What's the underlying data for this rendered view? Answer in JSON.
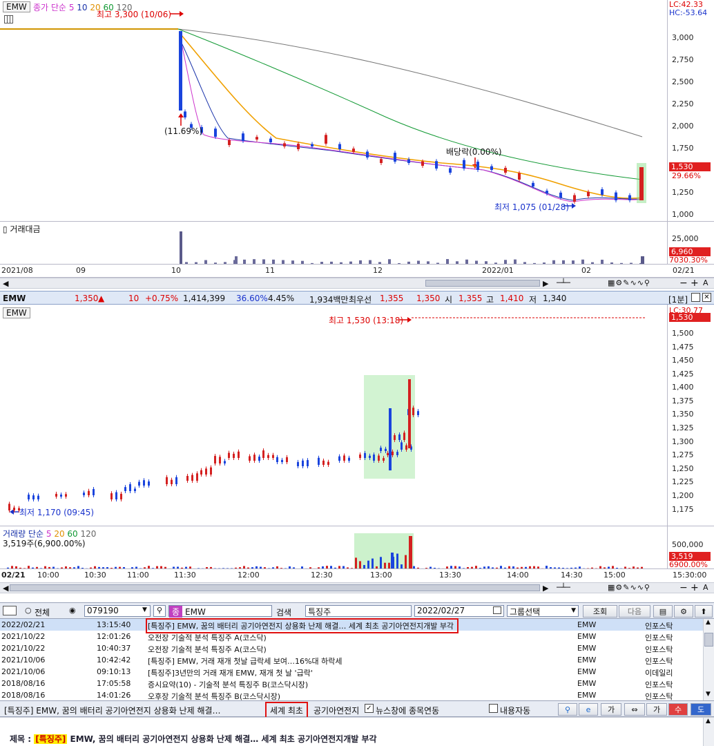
{
  "daily": {
    "symbol": "EMW",
    "ma_legend": {
      "label": "종가 단순",
      "periods": [
        "5",
        "10",
        "20",
        "60",
        "120"
      ],
      "colors": [
        "#cc33cc",
        "#1a33aa",
        "#f0a000",
        "#119933",
        "#666666"
      ]
    },
    "high_note": "최고 3,300 (10/06)",
    "low_note": "최저 1,075 (01/28)",
    "dividend_note": "배당락(0.00%)",
    "pct_note": "(11.69%)",
    "lc": "LC:42.33",
    "hc": "HC:-53.64",
    "y_ticks": [
      "3,000",
      "2,750",
      "2,500",
      "2,250",
      "2,000",
      "1,750",
      "1,500",
      "1,250",
      "1,000"
    ],
    "price_tag": "1,530",
    "pct_tag": "29.66%",
    "volume_label": "거래대금",
    "vol_ticks": [
      "25,000"
    ],
    "vol_tag": "6,960",
    "vol_pct": "7030.30%",
    "x_labels": [
      "2021/08",
      "09",
      "10",
      "11",
      "12",
      "2022/01",
      "02"
    ],
    "x_end": "02/21"
  },
  "quote_bar": {
    "symbol": "EMW",
    "price": "1,350",
    "arrow": "▲",
    "change": "10",
    "change_pct": "+0.75%",
    "volume": "1,414,399",
    "ratio": "36.60%",
    "turnover": "4.45%",
    "amount": "1,934백만",
    "best_label": "최우선",
    "ask": "1,355",
    "bid": "1,350",
    "open_label": "시",
    "open": "1,355",
    "high_label": "고",
    "high": "1,410",
    "low_label": "저",
    "low": "1,340",
    "interval": "[1분]"
  },
  "intraday": {
    "symbol": "EMW",
    "high_note": "최고 1,530 (13:18)",
    "low_note": "최저 1,170 (09:45)",
    "lc": "LC:30.77",
    "y_ticks": [
      "1,500",
      "1,475",
      "1,450",
      "1,425",
      "1,400",
      "1,375",
      "1,350",
      "1,325",
      "1,300",
      "1,275",
      "1,250",
      "1,225",
      "1,200",
      "1,175"
    ],
    "price_tag": "1,530",
    "vol_legend": {
      "label": "거래량 단순",
      "periods": [
        "5",
        "20",
        "60",
        "120"
      ]
    },
    "vol_info": "3,519주(6,900.00%)",
    "vol_ticks": [
      "500,000"
    ],
    "vol_tag": "3,519",
    "vol_pct": "6900.00%",
    "date": "02/21",
    "x_labels": [
      "10:00",
      "10:30",
      "11:00",
      "11:30",
      "12:00",
      "12:30",
      "13:00",
      "13:30",
      "14:00",
      "14:30",
      "15:00"
    ],
    "x_end": "15:30:00"
  },
  "news_toolbar": {
    "all_label": "전체",
    "code": "079190",
    "name": "EMW",
    "search_label": "검색",
    "search_value": "특징주",
    "date": "2022/02/27",
    "group_label": "그룹선택",
    "query_button": "조회",
    "next_button": "다음"
  },
  "news": [
    {
      "date": "2022/02/21",
      "time": "13:15:40",
      "title": "[특징주] EMW, 꿈의 배터리 공기아연전지 상용화 난제 해결… 세계 최초 공기아연전지개발 부각",
      "symbol": "EMW",
      "source": "인포스탁"
    },
    {
      "date": "2021/10/22",
      "time": "12:01:26",
      "title": "오전장 기술적 분석 특징주 A(코스닥)",
      "symbol": "EMW",
      "source": "인포스탁"
    },
    {
      "date": "2021/10/22",
      "time": "10:40:37",
      "title": "오전장 기술적 분석 특징주 A(코스닥)",
      "symbol": "EMW",
      "source": "인포스탁"
    },
    {
      "date": "2021/10/06",
      "time": "10:42:42",
      "title": "[특징주] EMW, 거래 재개 첫날 급락세 보여…16%대 하락세",
      "symbol": "EMW",
      "source": "인포스탁"
    },
    {
      "date": "2021/10/06",
      "time": "09:10:13",
      "title": "[특징주]3년만의 거래 재개 EMW, 재개 첫 날 '급락'",
      "symbol": "EMW",
      "source": "이데일리"
    },
    {
      "date": "2018/08/16",
      "time": "17:05:58",
      "title": "증시요약(10) - 기술적 분석 특징주 B(코스닥시장)",
      "symbol": "EMW",
      "source": "인포스탁"
    },
    {
      "date": "2018/08/16",
      "time": "14:01:26",
      "title": "오후장 기술적 분석 특징주 B(코스닥시장)",
      "symbol": "EMW",
      "source": "인포스탁"
    }
  ],
  "ticker_bar": {
    "headline_prefix": "[특징주] EMW, 꿈의 배터리 공기아연전지 상용화 난제 해결…",
    "highlight": "세계 최초",
    "headline_suffix": "공기아연전지",
    "news_link_label": "뉴스창에 종목연동",
    "auto_label": "내용자동"
  },
  "detail": {
    "label": "제목 :",
    "tag": "[특징주]",
    "title": "EMW, 꿈의 배터리 공기아연전지 상용화 난제 해결… 세계 최초 공기아연전지개발 부각"
  }
}
